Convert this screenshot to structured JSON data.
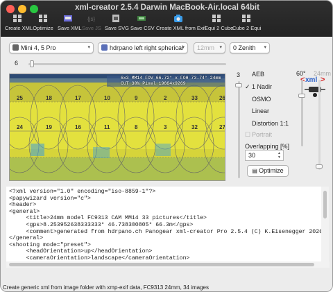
{
  "window": {
    "title": "xml-creator 2.5.4 Darwin MacBook-Air.local 64bit"
  },
  "toolbar": {
    "items": [
      {
        "label": "Create XML",
        "enabled": true
      },
      {
        "label": "Optimize",
        "enabled": true
      },
      {
        "label": "Save XML",
        "enabled": true
      },
      {
        "label": "Save JS",
        "enabled": false
      },
      {
        "label": "Save SVG",
        "enabled": true
      },
      {
        "label": "Save CSV",
        "enabled": true
      },
      {
        "label": "Create XML from Exif",
        "enabled": true
      },
      {
        "label": "Equi 2 Cube",
        "enabled": true
      },
      {
        "label": "Cube 2 Equi",
        "enabled": true
      }
    ]
  },
  "controls": {
    "camera": "Mini 4, 5 Pro",
    "projection": "hdrpano left right spherical",
    "focal": "12mm",
    "zenith": "0 Zenith",
    "slider_value": "6",
    "vertical_value": "3",
    "angle_label": "60°",
    "focal_side_label": "24mm"
  },
  "preview": {
    "hud_line1": "6x3 MM14 FOV 66.72° x FOH 73.74° 24mm",
    "hud_line2": "CUT 30% Pixel 19664x9269",
    "row1_numbers": [
      "25",
      "18",
      "17",
      "10",
      "9",
      "2",
      "33",
      "26"
    ],
    "row2_numbers": [
      "24",
      "19",
      "16",
      "11",
      "8",
      "3",
      "32",
      "27"
    ]
  },
  "options": {
    "aeb": {
      "label": "AEB",
      "checked": false
    },
    "nadir": {
      "label": "1 Nadir",
      "checked": true
    },
    "osmo": {
      "label": "OSMO",
      "checked": false
    },
    "linear": {
      "label": "Linear",
      "checked": false
    },
    "distortion": {
      "label": "Distortion 1:1",
      "checked": false
    },
    "portrait": {
      "label": "Portrait",
      "checked": false
    }
  },
  "overlap": {
    "label": "Overlapping [%]",
    "value": "30"
  },
  "optimize_button": "Optimize",
  "xml_lines": [
    "<?xml version=\"1.0\" encoding=\"iso-8859-1\"?>",
    "<papywizard version=\"c\">",
    "<header>",
    "<general>",
    "     <title>24mm model FC9313 CAM MM14 33 pictures</title>",
    "     <gps>8.253952638333333° 46.738300805° 66.3m</gps>",
    "     <comment>generated from hdrpano.ch Panogear xml-creator Pro 2.5.4 (C) K.Eisenegger 2026",
    "</general>",
    "<shooting mode=\"preset\">",
    "     <headOrientation>up</headOrientation>",
    "     <cameraOrientation>landscape</cameraOrientation>"
  ],
  "status": "Create generic xml from image folder with xmp-exif data, FC9313 24mm, 34 images",
  "colors": {
    "preview_bg": "#dedc3c",
    "preview_green": "#8fc85a",
    "accent_red": "#d62020"
  }
}
